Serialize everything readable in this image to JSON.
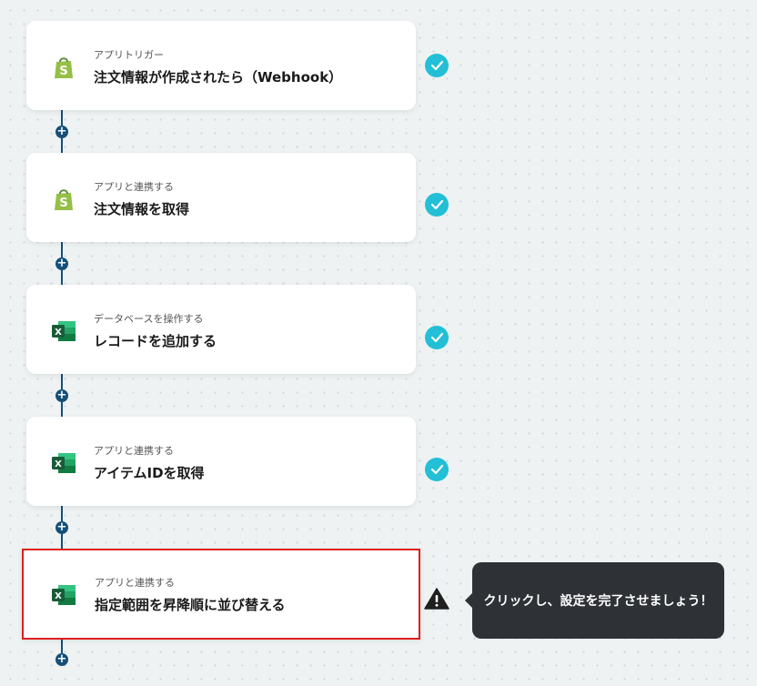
{
  "steps": [
    {
      "label": "アプリトリガー",
      "title": "注文情報が作成されたら（Webhook）",
      "app_icon": "shopify-icon",
      "status": "complete"
    },
    {
      "label": "アプリと連携する",
      "title": "注文情報を取得",
      "app_icon": "shopify-icon",
      "status": "complete"
    },
    {
      "label": "データベースを操作する",
      "title": "レコードを追加する",
      "app_icon": "excel-icon",
      "status": "complete"
    },
    {
      "label": "アプリと連携する",
      "title": "アイテムIDを取得",
      "app_icon": "excel-icon",
      "status": "complete"
    },
    {
      "label": "アプリと連携する",
      "title": "指定範囲を昇降順に並び替える",
      "app_icon": "excel-icon",
      "status": "warning"
    }
  ],
  "add_step_symbol": "+",
  "tooltip": {
    "text": "クリックし、設定を完了させましょう！"
  },
  "colors": {
    "connector": "#14507a",
    "check": "#22bfd6",
    "highlight": "#e01e1e",
    "tooltip_bg": "#2e3136"
  }
}
